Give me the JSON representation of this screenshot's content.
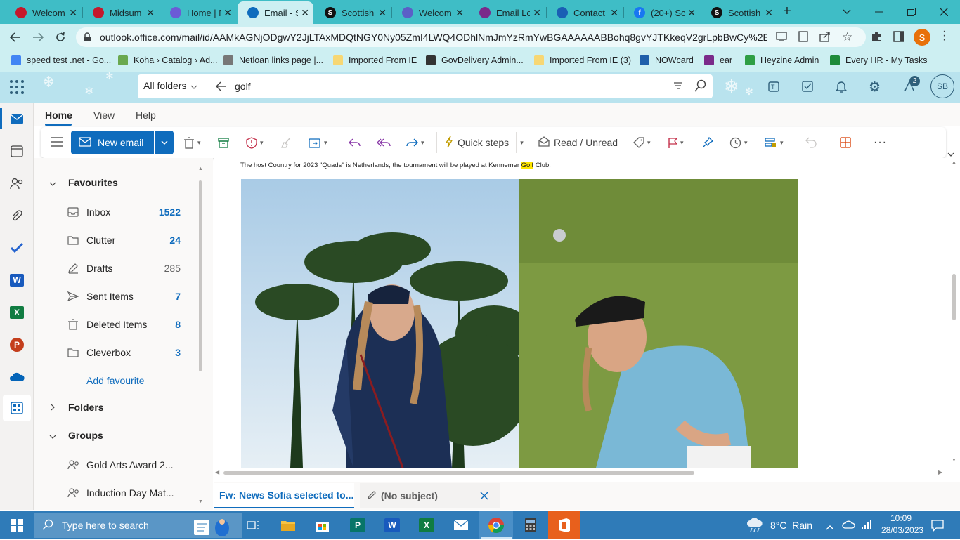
{
  "browser": {
    "tabs": [
      {
        "title": "Welcom",
        "color": "#c4182c"
      },
      {
        "title": "Midsum",
        "color": "#c4182c"
      },
      {
        "title": "Home | N",
        "color": "#6b5bd6"
      },
      {
        "title": "Email - S",
        "color": "#0f6cbd",
        "active": true
      },
      {
        "title": "Scottish",
        "color": "#111111",
        "letter": "S"
      },
      {
        "title": "Welcom",
        "color": "#5b5fc7"
      },
      {
        "title": "Email Lo",
        "color": "#7a2a8a"
      },
      {
        "title": "Contact",
        "color": "#1a5fb4"
      },
      {
        "title": "(20+) Sc",
        "color": "#1877f2",
        "letter": "f"
      },
      {
        "title": "Scottish",
        "color": "#111111",
        "letter": "S"
      }
    ],
    "new_tab": "+",
    "url": "outlook.office.com/mail/id/AAMkAGNjODgwY2JjLTAxMDQtNGY0Ny05ZmI4LWQ4ODhlNmJmYzRmYwBGAAAAAABBohq8gvYJTKkeqV2grLpbBwCy%2BD...",
    "profile_initial": "S",
    "bookmarks": [
      {
        "label": "speed test .net - Go...",
        "color": "#4285f4"
      },
      {
        "label": "Koha › Catalog › Ad...",
        "color": "#6aa84f"
      },
      {
        "label": "Netloan links page |...",
        "color": "#777777"
      },
      {
        "label": "Imported From IE",
        "color": "#f7d774"
      },
      {
        "label": "GovDelivery Admin...",
        "color": "#333333"
      },
      {
        "label": "Imported From IE (3)",
        "color": "#f7d774"
      },
      {
        "label": "NOWcard",
        "color": "#1f5faa"
      },
      {
        "label": "ear",
        "color": "#7a2a8a"
      },
      {
        "label": "Heyzine Admin",
        "color": "#2e9e44"
      },
      {
        "label": "Every HR - My Tasks",
        "color": "#1e8b3a"
      }
    ]
  },
  "owa": {
    "search_scope": "All folders",
    "search_query": "golf",
    "notification_badge": "2",
    "avatar_initials": "SB",
    "ribbon_tabs": [
      "Home",
      "View",
      "Help"
    ],
    "new_email_label": "New email",
    "quick_steps_label": "Quick steps",
    "read_unread_label": "Read / Unread",
    "folders": {
      "favourites_label": "Favourites",
      "items": [
        {
          "label": "Inbox",
          "count": "1522",
          "bold": true
        },
        {
          "label": "Clutter",
          "count": "24",
          "bold": true
        },
        {
          "label": "Drafts",
          "count": "285",
          "bold": false
        },
        {
          "label": "Sent Items",
          "count": "7",
          "bold": true
        },
        {
          "label": "Deleted Items",
          "count": "8",
          "bold": true
        },
        {
          "label": "Cleverbox",
          "count": "3",
          "bold": true
        }
      ],
      "add_favourite_label": "Add favourite",
      "folders_label": "Folders",
      "groups_label": "Groups",
      "groups": [
        "Gold Arts Award 2...",
        "Induction Day Mat..."
      ]
    },
    "reading": {
      "text_before": "The host Country for 2023 \"Quads\" is Netherlands, the tournament will be played at Kennemer ",
      "highlight": "Golf",
      "text_after": " Club."
    },
    "bottom_tabs": [
      {
        "label": "Fw: News Sofia selected to..."
      },
      {
        "label": "(No subject)"
      }
    ]
  },
  "taskbar": {
    "search_placeholder": "Type here to search",
    "weather": "8°C  Rain",
    "time": "10:09",
    "date": "28/03/2023"
  }
}
